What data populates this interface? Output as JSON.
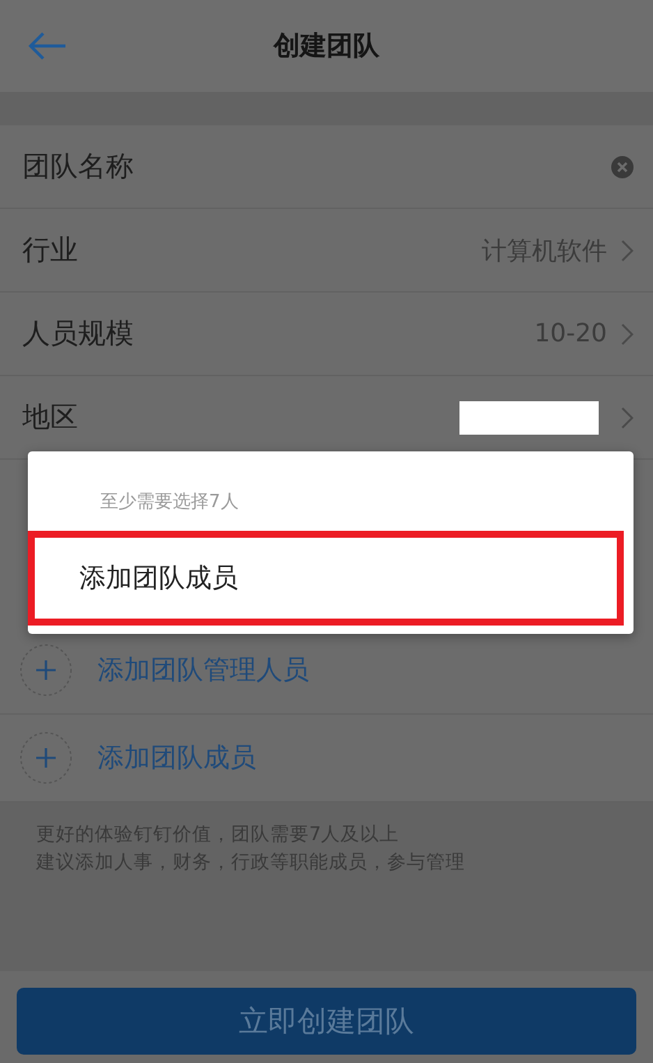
{
  "header": {
    "title": "创建团队"
  },
  "form_rows": [
    {
      "kind": "input",
      "label": "团队名称"
    },
    {
      "kind": "select",
      "label": "行业",
      "value": "计算机软件"
    },
    {
      "kind": "select",
      "label": "人员规模",
      "value": "10-20"
    },
    {
      "kind": "redacted",
      "label": "地区"
    }
  ],
  "add_actions": [
    {
      "label": "添加团队管理人员"
    },
    {
      "label": "添加团队成员"
    }
  ],
  "tip_lines": [
    "更好的体验钉钉价值，团队需要7人及以上",
    "建议添加人事，财务，行政等职能成员，参与管理"
  ],
  "create_button": "立即创建团队",
  "popup": {
    "hint": "至少需要选择7人",
    "items": [
      {
        "label": "添加团队成员",
        "highlighted": true
      }
    ]
  }
}
